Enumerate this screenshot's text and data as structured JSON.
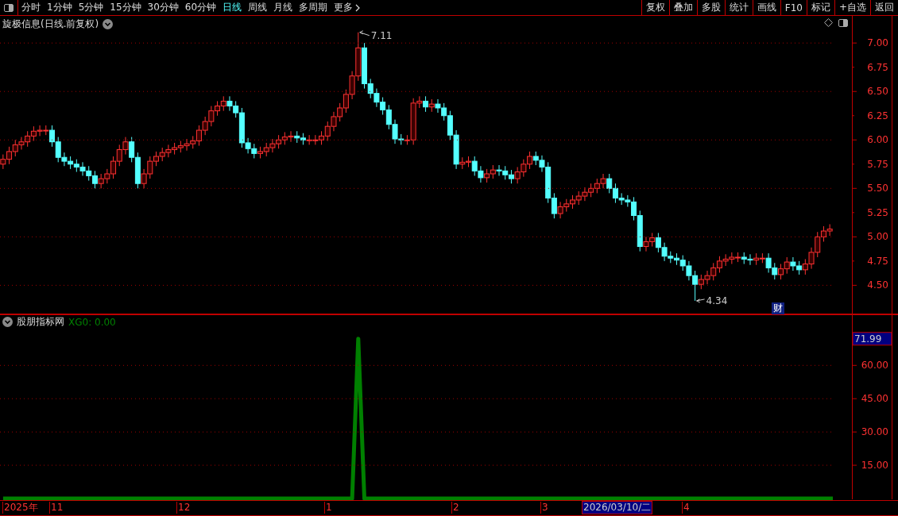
{
  "toolbar": {
    "tabs": [
      {
        "label": "分时",
        "selected": false
      },
      {
        "label": "1分钟",
        "selected": false
      },
      {
        "label": "5分钟",
        "selected": false
      },
      {
        "label": "15分钟",
        "selected": false
      },
      {
        "label": "30分钟",
        "selected": false
      },
      {
        "label": "60分钟",
        "selected": false
      },
      {
        "label": "日线",
        "selected": true
      },
      {
        "label": "周线",
        "selected": false
      },
      {
        "label": "月线",
        "selected": false
      },
      {
        "label": "多周期",
        "selected": false
      },
      {
        "label": "更多",
        "selected": false
      }
    ],
    "buttons": [
      "复权",
      "叠加",
      "多股",
      "统计",
      "画线",
      "F10",
      "标记",
      "+自选",
      "返回"
    ]
  },
  "price_chart": {
    "title": "旋极信息(日线.前复权)",
    "high_label": "7.11",
    "low_label": "4.34",
    "event_badge": "财",
    "chart_data": {
      "type": "candlestick",
      "grid": true,
      "ylim": [
        4.2,
        7.28
      ],
      "categories": [
        null,
        null,
        null,
        null,
        null,
        null,
        null,
        null,
        null,
        null,
        null,
        null,
        null,
        null,
        null,
        null,
        null,
        null,
        null,
        null,
        null,
        null,
        null,
        null,
        null,
        null,
        null,
        null,
        null,
        null,
        null,
        null,
        null,
        null,
        null,
        null,
        null,
        null,
        null,
        null,
        null,
        null,
        null,
        null,
        null,
        null,
        null,
        null,
        null,
        null,
        null,
        null,
        null,
        null,
        null,
        null,
        null,
        null,
        null,
        null,
        null,
        null,
        null,
        null,
        null,
        null,
        null,
        null,
        null,
        null,
        null,
        null,
        null,
        null,
        null,
        null,
        null,
        null,
        null,
        null,
        null,
        null,
        null,
        null,
        null,
        null,
        null,
        null,
        null,
        null,
        null,
        null,
        null,
        null,
        null,
        null,
        null,
        null,
        null,
        null,
        null,
        null,
        null,
        null,
        null,
        null,
        null,
        null,
        null,
        null,
        null,
        null,
        null,
        null,
        null,
        null,
        null,
        null,
        null,
        null,
        null,
        null,
        null,
        null,
        null,
        null,
        null,
        null,
        null,
        null,
        null,
        null,
        null,
        null,
        null,
        null
      ],
      "yticks": [
        {
          "value": 7,
          "label": "7.00"
        },
        {
          "value": 6.75,
          "label": "6.75"
        },
        {
          "value": 6.5,
          "label": "6.50"
        },
        {
          "value": 6.25,
          "label": "6.25"
        },
        {
          "value": 6,
          "label": "6.00"
        },
        {
          "value": 5.75,
          "label": "5.75"
        },
        {
          "value": 5.5,
          "label": "5.50"
        },
        {
          "value": 5.25,
          "label": "5.25"
        },
        {
          "value": 5,
          "label": "5.00"
        },
        {
          "value": 4.75,
          "label": "4.75"
        },
        {
          "value": 4.5,
          "label": "4.50"
        }
      ],
      "ohlc": [
        [
          5.75,
          5.85,
          5.7,
          5.8
        ],
        [
          5.8,
          5.93,
          5.75,
          5.88
        ],
        [
          5.88,
          6.0,
          5.83,
          5.95
        ],
        [
          5.95,
          6.03,
          5.9,
          5.98
        ],
        [
          5.98,
          6.09,
          5.93,
          6.04
        ],
        [
          6.04,
          6.14,
          5.99,
          6.09
        ],
        [
          6.09,
          6.15,
          6.04,
          6.1
        ],
        [
          6.1,
          6.15,
          6.05,
          6.1
        ],
        [
          6.1,
          6.15,
          5.93,
          5.98
        ],
        [
          5.98,
          6.03,
          5.77,
          5.82
        ],
        [
          5.82,
          5.87,
          5.73,
          5.78
        ],
        [
          5.78,
          5.83,
          5.7,
          5.75
        ],
        [
          5.75,
          5.8,
          5.67,
          5.72
        ],
        [
          5.72,
          5.77,
          5.63,
          5.68
        ],
        [
          5.68,
          5.73,
          5.58,
          5.63
        ],
        [
          5.63,
          5.68,
          5.5,
          5.55
        ],
        [
          5.55,
          5.65,
          5.5,
          5.6
        ],
        [
          5.6,
          5.7,
          5.55,
          5.65
        ],
        [
          5.65,
          5.83,
          5.6,
          5.78
        ],
        [
          5.78,
          5.95,
          5.73,
          5.9
        ],
        [
          5.9,
          6.03,
          5.85,
          5.98
        ],
        [
          5.98,
          6.03,
          5.77,
          5.82
        ],
        [
          5.82,
          5.87,
          5.5,
          5.55
        ],
        [
          5.55,
          5.7,
          5.5,
          5.65
        ],
        [
          5.65,
          5.83,
          5.6,
          5.78
        ],
        [
          5.78,
          5.88,
          5.73,
          5.83
        ],
        [
          5.83,
          5.92,
          5.78,
          5.87
        ],
        [
          5.87,
          5.95,
          5.82,
          5.9
        ],
        [
          5.9,
          5.97,
          5.85,
          5.92
        ],
        [
          5.92,
          5.99,
          5.87,
          5.94
        ],
        [
          5.94,
          6.01,
          5.89,
          5.96
        ],
        [
          5.96,
          6.04,
          5.91,
          5.99
        ],
        [
          5.99,
          6.15,
          5.94,
          6.1
        ],
        [
          6.1,
          6.24,
          6.05,
          6.19
        ],
        [
          6.19,
          6.35,
          6.14,
          6.3
        ],
        [
          6.3,
          6.4,
          6.25,
          6.35
        ],
        [
          6.35,
          6.45,
          6.3,
          6.4
        ],
        [
          6.4,
          6.45,
          6.3,
          6.35
        ],
        [
          6.35,
          6.4,
          6.23,
          6.28
        ],
        [
          6.28,
          6.33,
          5.92,
          5.97
        ],
        [
          5.97,
          6.02,
          5.86,
          5.91
        ],
        [
          5.91,
          5.96,
          5.81,
          5.86
        ],
        [
          5.86,
          5.93,
          5.81,
          5.88
        ],
        [
          5.88,
          5.97,
          5.83,
          5.92
        ],
        [
          5.92,
          6.01,
          5.87,
          5.96
        ],
        [
          5.96,
          6.05,
          5.91,
          6.0
        ],
        [
          6.0,
          6.08,
          5.95,
          6.03
        ],
        [
          6.03,
          6.09,
          5.98,
          6.04
        ],
        [
          6.04,
          6.09,
          5.97,
          6.02
        ],
        [
          6.02,
          6.07,
          5.95,
          6.0
        ],
        [
          6.0,
          6.05,
          5.95,
          6.0
        ],
        [
          6.0,
          6.05,
          5.95,
          6.0
        ],
        [
          6.0,
          6.09,
          5.95,
          6.04
        ],
        [
          6.04,
          6.19,
          5.99,
          6.14
        ],
        [
          6.14,
          6.29,
          6.09,
          6.24
        ],
        [
          6.24,
          6.38,
          6.19,
          6.33
        ],
        [
          6.33,
          6.52,
          6.28,
          6.47
        ],
        [
          6.47,
          6.71,
          6.42,
          6.66
        ],
        [
          6.66,
          7.11,
          6.61,
          6.95
        ],
        [
          6.95,
          7.0,
          6.53,
          6.58
        ],
        [
          6.58,
          6.63,
          6.43,
          6.48
        ],
        [
          6.48,
          6.53,
          6.34,
          6.39
        ],
        [
          6.39,
          6.44,
          6.26,
          6.31
        ],
        [
          6.31,
          6.36,
          6.11,
          6.16
        ],
        [
          6.16,
          6.21,
          5.96,
          6.01
        ],
        [
          6.01,
          6.06,
          5.95,
          6.0
        ],
        [
          6.0,
          6.05,
          5.95,
          6.0
        ],
        [
          6.0,
          6.43,
          5.95,
          6.38
        ],
        [
          6.38,
          6.45,
          6.33,
          6.4
        ],
        [
          6.4,
          6.45,
          6.29,
          6.34
        ],
        [
          6.34,
          6.42,
          6.29,
          6.37
        ],
        [
          6.37,
          6.42,
          6.28,
          6.33
        ],
        [
          6.33,
          6.38,
          6.2,
          6.25
        ],
        [
          6.25,
          6.3,
          6.0,
          6.05
        ],
        [
          6.05,
          6.1,
          5.7,
          5.75
        ],
        [
          5.75,
          5.82,
          5.7,
          5.77
        ],
        [
          5.77,
          5.83,
          5.72,
          5.78
        ],
        [
          5.78,
          5.83,
          5.63,
          5.68
        ],
        [
          5.68,
          5.73,
          5.56,
          5.61
        ],
        [
          5.61,
          5.7,
          5.56,
          5.65
        ],
        [
          5.65,
          5.74,
          5.6,
          5.69
        ],
        [
          5.69,
          5.74,
          5.63,
          5.68
        ],
        [
          5.68,
          5.73,
          5.59,
          5.64
        ],
        [
          5.64,
          5.69,
          5.55,
          5.6
        ],
        [
          5.6,
          5.72,
          5.55,
          5.67
        ],
        [
          5.67,
          5.8,
          5.62,
          5.75
        ],
        [
          5.75,
          5.88,
          5.7,
          5.83
        ],
        [
          5.83,
          5.88,
          5.74,
          5.79
        ],
        [
          5.79,
          5.84,
          5.67,
          5.72
        ],
        [
          5.72,
          5.77,
          5.35,
          5.4
        ],
        [
          5.4,
          5.45,
          5.19,
          5.24
        ],
        [
          5.24,
          5.36,
          5.19,
          5.31
        ],
        [
          5.31,
          5.39,
          5.26,
          5.34
        ],
        [
          5.34,
          5.43,
          5.29,
          5.38
        ],
        [
          5.38,
          5.47,
          5.33,
          5.42
        ],
        [
          5.42,
          5.51,
          5.37,
          5.46
        ],
        [
          5.46,
          5.55,
          5.41,
          5.5
        ],
        [
          5.5,
          5.6,
          5.45,
          5.55
        ],
        [
          5.55,
          5.65,
          5.5,
          5.6
        ],
        [
          5.6,
          5.65,
          5.45,
          5.5
        ],
        [
          5.5,
          5.55,
          5.35,
          5.4
        ],
        [
          5.4,
          5.45,
          5.33,
          5.38
        ],
        [
          5.38,
          5.43,
          5.31,
          5.36
        ],
        [
          5.36,
          5.41,
          5.17,
          5.22
        ],
        [
          5.22,
          5.27,
          4.85,
          4.9
        ],
        [
          4.9,
          5.0,
          4.85,
          4.95
        ],
        [
          4.95,
          5.04,
          4.9,
          4.99
        ],
        [
          4.99,
          5.04,
          4.84,
          4.89
        ],
        [
          4.89,
          4.94,
          4.75,
          4.8
        ],
        [
          4.8,
          4.85,
          4.73,
          4.78
        ],
        [
          4.78,
          4.83,
          4.71,
          4.76
        ],
        [
          4.76,
          4.81,
          4.65,
          4.7
        ],
        [
          4.7,
          4.75,
          4.55,
          4.6
        ],
        [
          4.6,
          4.65,
          4.34,
          4.51
        ],
        [
          4.51,
          4.61,
          4.46,
          4.56
        ],
        [
          4.56,
          4.65,
          4.51,
          4.6
        ],
        [
          4.6,
          4.73,
          4.55,
          4.68
        ],
        [
          4.68,
          4.8,
          4.63,
          4.75
        ],
        [
          4.75,
          4.82,
          4.7,
          4.77
        ],
        [
          4.77,
          4.84,
          4.72,
          4.79
        ],
        [
          4.79,
          4.84,
          4.74,
          4.79
        ],
        [
          4.79,
          4.84,
          4.72,
          4.77
        ],
        [
          4.77,
          4.82,
          4.71,
          4.76
        ],
        [
          4.76,
          4.83,
          4.71,
          4.78
        ],
        [
          4.78,
          4.83,
          4.73,
          4.78
        ],
        [
          4.78,
          4.83,
          4.63,
          4.68
        ],
        [
          4.68,
          4.73,
          4.56,
          4.61
        ],
        [
          4.61,
          4.72,
          4.56,
          4.67
        ],
        [
          4.67,
          4.79,
          4.62,
          4.74
        ],
        [
          4.74,
          4.79,
          4.65,
          4.7
        ],
        [
          4.7,
          4.75,
          4.61,
          4.66
        ],
        [
          4.66,
          4.77,
          4.61,
          4.72
        ],
        [
          4.72,
          4.89,
          4.67,
          4.84
        ],
        [
          4.84,
          5.05,
          4.79,
          5.0
        ],
        [
          5.0,
          5.11,
          4.95,
          5.06
        ],
        [
          5.06,
          5.13,
          5.01,
          5.08
        ]
      ]
    }
  },
  "indicator": {
    "title": "股朋指标网",
    "readout_rest": ": 0.00",
    "current_value": "71.99",
    "chart_data": {
      "type": "line",
      "grid": true,
      "ylim": [
        0,
        83
      ],
      "yticks": [
        {
          "value": 15,
          "label": "15.00"
        },
        {
          "value": 30,
          "label": "30.00"
        },
        {
          "value": 45,
          "label": "45.00"
        },
        {
          "value": 60,
          "label": "60.00"
        }
      ],
      "series": [
        {
          "name": "XG0",
          "color": "#008000",
          "values": [
            0,
            0,
            0,
            0,
            0,
            0,
            0,
            0,
            0,
            0,
            0,
            0,
            0,
            0,
            0,
            0,
            0,
            0,
            0,
            0,
            0,
            0,
            0,
            0,
            0,
            0,
            0,
            0,
            0,
            0,
            0,
            0,
            0,
            0,
            0,
            0,
            0,
            0,
            0,
            0,
            0,
            0,
            0,
            0,
            0,
            0,
            0,
            0,
            0,
            0,
            0,
            0,
            0,
            0,
            0,
            0,
            0,
            0,
            72,
            0,
            0,
            0,
            0,
            0,
            0,
            0,
            0,
            0,
            0,
            0,
            0,
            0,
            0,
            0,
            0,
            0,
            0,
            0,
            0,
            0,
            0,
            0,
            0,
            0,
            0,
            0,
            0,
            0,
            0,
            0,
            0,
            0,
            0,
            0,
            0,
            0,
            0,
            0,
            0,
            0,
            0,
            0,
            0,
            0,
            0,
            0,
            0,
            0,
            0,
            0,
            0,
            0,
            0,
            0,
            0,
            0,
            0,
            0,
            0,
            0,
            0,
            0,
            0,
            0,
            0,
            0,
            0,
            0,
            0,
            0,
            0,
            0,
            0,
            0,
            0,
            0
          ]
        }
      ]
    }
  },
  "time_axis": {
    "labels": [
      {
        "text": "2025年",
        "selected": false
      },
      {
        "text": "11",
        "selected": false
      },
      {
        "text": "12",
        "selected": false
      },
      {
        "text": "1",
        "selected": false
      },
      {
        "text": "2",
        "selected": false
      },
      {
        "text": "3",
        "selected": false
      },
      {
        "text": "2026/03/10/二",
        "selected": true
      },
      {
        "text": "4",
        "selected": false
      }
    ]
  }
}
